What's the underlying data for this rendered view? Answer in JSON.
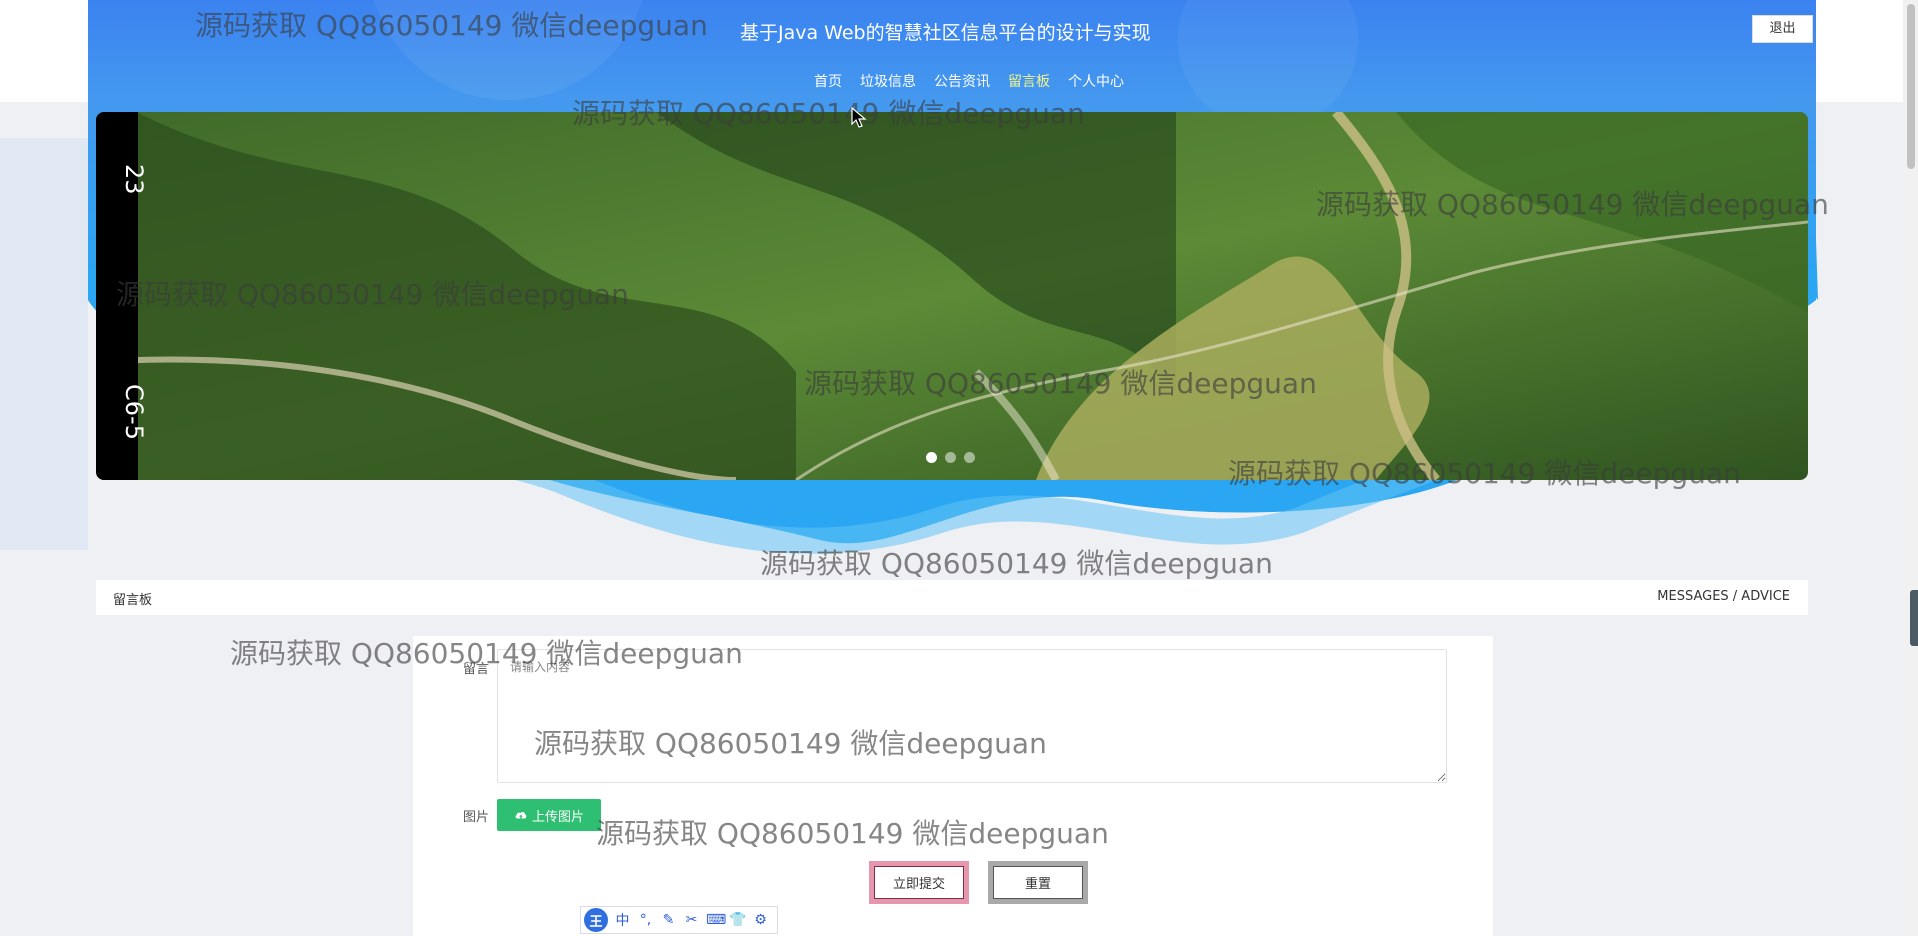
{
  "header": {
    "title": "基于Java Web的智慧社区信息平台的设计与实现",
    "logout_label": "退出"
  },
  "nav": {
    "items": [
      {
        "label": "首页"
      },
      {
        "label": "垃圾信息"
      },
      {
        "label": "公告资讯"
      },
      {
        "label": "留言板"
      },
      {
        "label": "个人中心"
      }
    ],
    "active_item": "留言板"
  },
  "carousel": {
    "slide_count": 3,
    "active_slide": 1,
    "image_overlay_text": [
      "23",
      "C6-5"
    ]
  },
  "section": {
    "title": "留言板",
    "subtitle": "MESSAGES / ADVICE"
  },
  "form": {
    "message_label": "留言",
    "message_placeholder": "请输入内容",
    "image_label": "图片",
    "upload_label": "上传图片",
    "submit_label": "立即提交",
    "reset_label": "重置"
  },
  "ime_toolbar": {
    "logo": "王",
    "mode": "中"
  },
  "watermark": {
    "text": "源码获取 QQ86050149 微信deepguan"
  },
  "colors": {
    "header_blue": "#3b82f0",
    "active_nav": "#f3f58a",
    "upload_green": "#2fbf72",
    "submit_border": "#e797ad"
  }
}
